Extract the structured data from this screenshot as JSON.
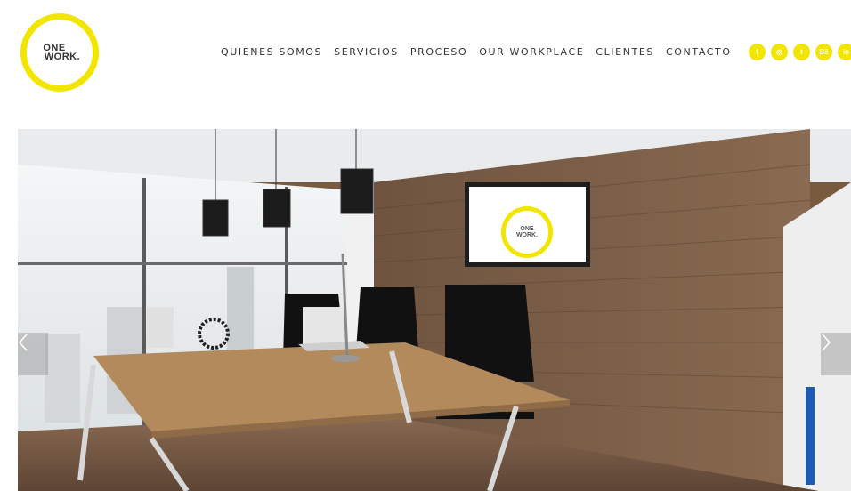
{
  "brand": {
    "logo_line1": "ONE",
    "logo_line2": "WORK.",
    "accent_color": "#f2e500"
  },
  "nav": {
    "items": [
      {
        "label": "QUIENES SOMOS"
      },
      {
        "label": "SERVICIOS"
      },
      {
        "label": "PROCESO"
      },
      {
        "label": "OUR WORKPLACE"
      },
      {
        "label": "CLIENTES"
      },
      {
        "label": "CONTACTO"
      }
    ]
  },
  "social": {
    "icons": [
      {
        "name": "facebook-icon",
        "glyph": "f"
      },
      {
        "name": "instagram-icon",
        "glyph": "◎"
      },
      {
        "name": "twitter-icon",
        "glyph": "t"
      },
      {
        "name": "behance-icon",
        "glyph": "Bē"
      },
      {
        "name": "linkedin-icon",
        "glyph": "in"
      }
    ]
  },
  "hero": {
    "screen_logo_line1": "ONE",
    "screen_logo_line2": "WORK."
  }
}
